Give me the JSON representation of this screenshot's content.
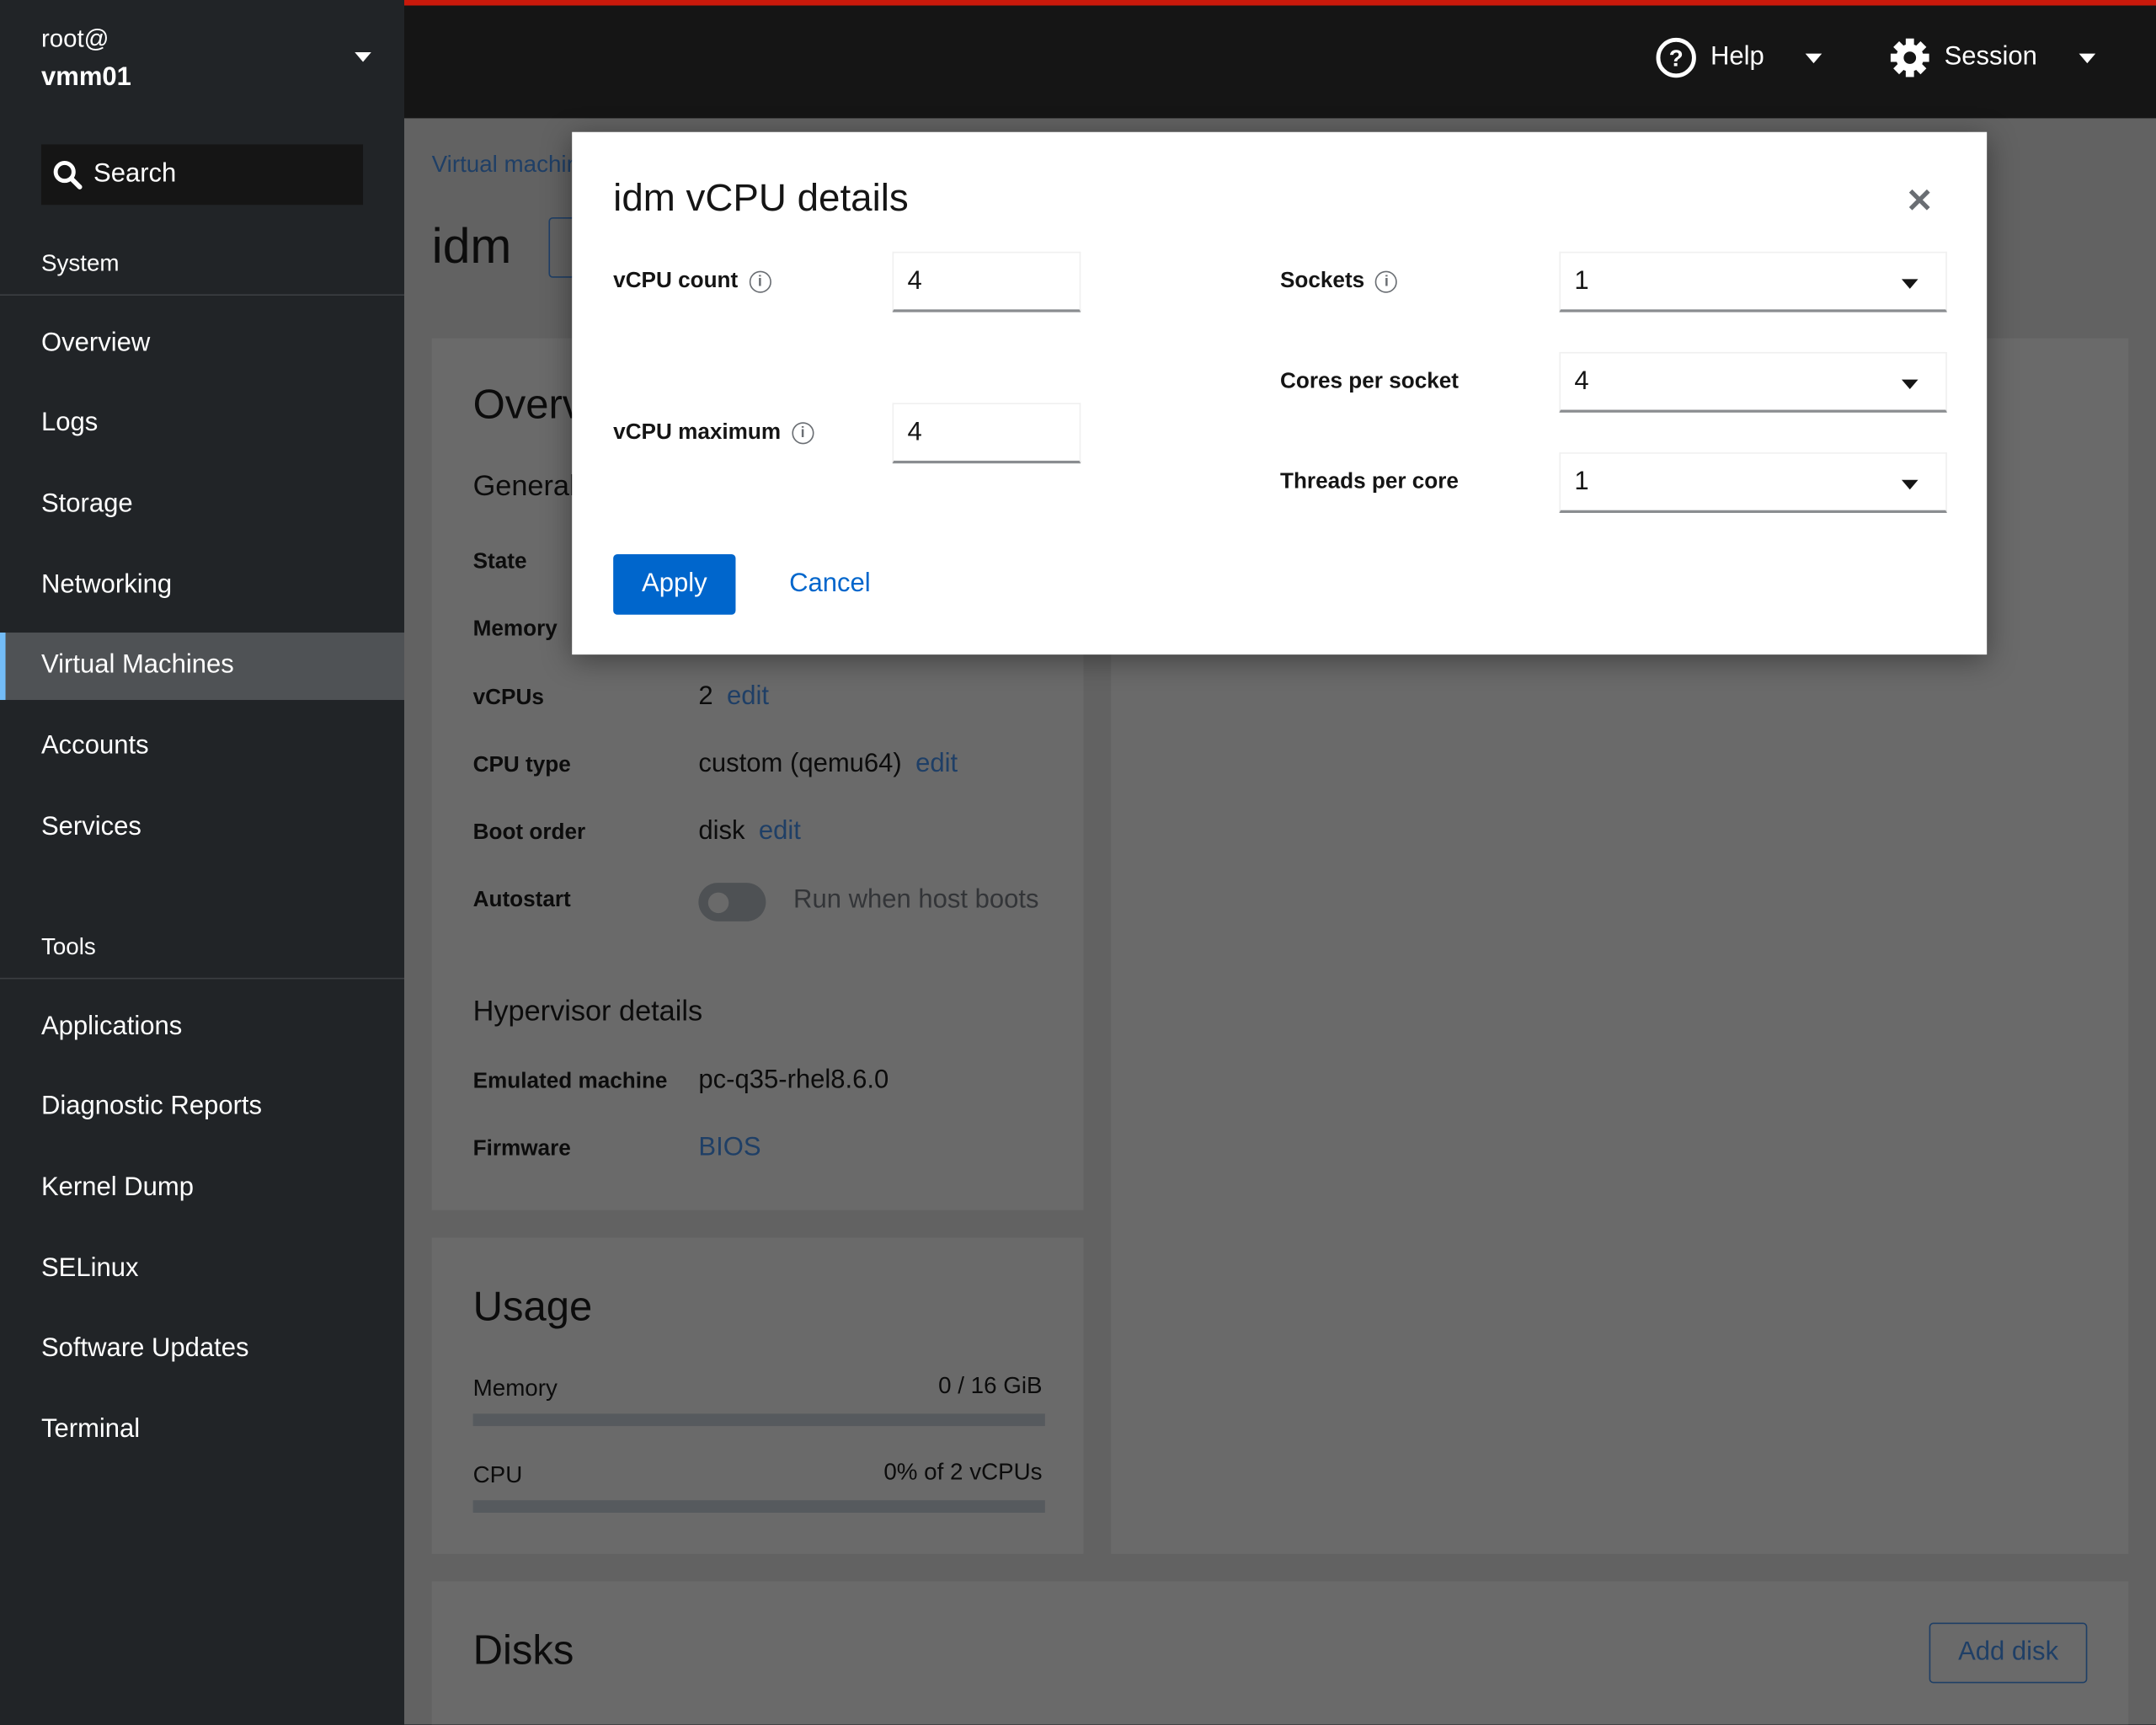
{
  "host": {
    "user": "root@",
    "name": "vmm01"
  },
  "search": {
    "label": "Search"
  },
  "sidebar": {
    "system_heading": "System",
    "tools_heading": "Tools",
    "system_items": [
      {
        "label": "Overview"
      },
      {
        "label": "Logs"
      },
      {
        "label": "Storage"
      },
      {
        "label": "Networking"
      },
      {
        "label": "Virtual Machines",
        "active": true
      },
      {
        "label": "Accounts"
      },
      {
        "label": "Services"
      }
    ],
    "tools_items": [
      {
        "label": "Applications"
      },
      {
        "label": "Diagnostic Reports"
      },
      {
        "label": "Kernel Dump"
      },
      {
        "label": "SELinux"
      },
      {
        "label": "Software Updates"
      },
      {
        "label": "Terminal"
      }
    ]
  },
  "topbar": {
    "help": "Help",
    "session": "Session",
    "accent": "#c9190b"
  },
  "page": {
    "breadcrumb": "Virtual machines",
    "vm_name": "idm",
    "overview": {
      "title": "Overview",
      "general": "General",
      "rows": [
        {
          "label": "State",
          "value": ""
        },
        {
          "label": "Memory",
          "value": ""
        },
        {
          "label": "vCPUs",
          "value": "2",
          "link": "edit"
        },
        {
          "label": "CPU type",
          "value": "custom (qemu64)",
          "link": "edit"
        },
        {
          "label": "Boot order",
          "value": "disk",
          "link": "edit"
        }
      ],
      "autostart": {
        "label": "Autostart",
        "text": "Run when host boots",
        "on": false
      },
      "hypervisor": "Hypervisor details",
      "emulated_label": "Emulated machine",
      "emulated_value": "pc-q35-rhel8.6.0",
      "firmware_label": "Firmware",
      "firmware_value": "BIOS"
    },
    "usage": {
      "title": "Usage",
      "memory_label": "Memory",
      "memory_value": "0 / 16 GiB",
      "memory_fraction": 0,
      "cpu_label": "CPU",
      "cpu_value": "0% of 2 vCPUs",
      "cpu_fraction": 0
    },
    "disks": {
      "title": "Disks",
      "add": "Add disk"
    }
  },
  "modal": {
    "title": "idm vCPU details",
    "vcpu_count_label": "vCPU count",
    "vcpu_count": "4",
    "vcpu_max_label": "vCPU maximum",
    "vcpu_max": "4",
    "sockets_label": "Sockets",
    "sockets": "1",
    "cores_label": "Cores per socket",
    "cores": "4",
    "threads_label": "Threads per core",
    "threads": "1",
    "apply": "Apply",
    "cancel": "Cancel",
    "primary_color": "#0066cc"
  }
}
